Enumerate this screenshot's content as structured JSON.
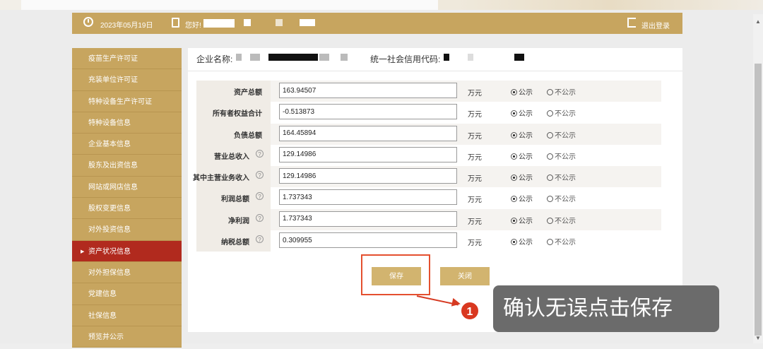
{
  "header": {
    "date": "2023年05月19日",
    "greeting": "您好!",
    "logout_label": "退出登录"
  },
  "sidebar": {
    "items": [
      {
        "label": "疫苗生产许可证"
      },
      {
        "label": "充装单位许可证"
      },
      {
        "label": "特种设备生产许可证"
      },
      {
        "label": "特种设备信息"
      },
      {
        "label": "企业基本信息"
      },
      {
        "label": "股东及出资信息"
      },
      {
        "label": "网站或网店信息"
      },
      {
        "label": "股权变更信息"
      },
      {
        "label": "对外投资信息"
      },
      {
        "label": "资产状况信息",
        "active": true
      },
      {
        "label": "对外担保信息"
      },
      {
        "label": "党建信息"
      },
      {
        "label": "社保信息"
      },
      {
        "label": "预览并公示"
      }
    ]
  },
  "company": {
    "name_label": "企业名称:",
    "credit_label": "统一社会信用代码:"
  },
  "form": {
    "unit": "万元",
    "public_label": "公示",
    "private_label": "不公示",
    "rows": [
      {
        "label": "资产总额",
        "value": "163.94507",
        "help": false,
        "public": true
      },
      {
        "label": "所有者权益合计",
        "value": "-0.513873",
        "help": false,
        "public": true
      },
      {
        "label": "负债总额",
        "value": "164.45894",
        "help": false,
        "public": true
      },
      {
        "label": "营业总收入",
        "value": "129.14986",
        "help": true,
        "public": true
      },
      {
        "label": "其中主营业务收入",
        "value": "129.14986",
        "help": true,
        "public": true
      },
      {
        "label": "利润总额",
        "value": "1.737343",
        "help": true,
        "public": true
      },
      {
        "label": "净利润",
        "value": "1.737343",
        "help": true,
        "public": true
      },
      {
        "label": "纳税总额",
        "value": "0.309955",
        "help": true,
        "public": true
      }
    ]
  },
  "buttons": {
    "save_label": "保存",
    "close_label": "关闭"
  },
  "annotation": {
    "step_number": "1",
    "callout_text": "确认无误点击保存"
  },
  "colors": {
    "brand_gold": "#c7a55f",
    "active_red": "#b12a1e",
    "highlight_red": "#e4502f"
  }
}
